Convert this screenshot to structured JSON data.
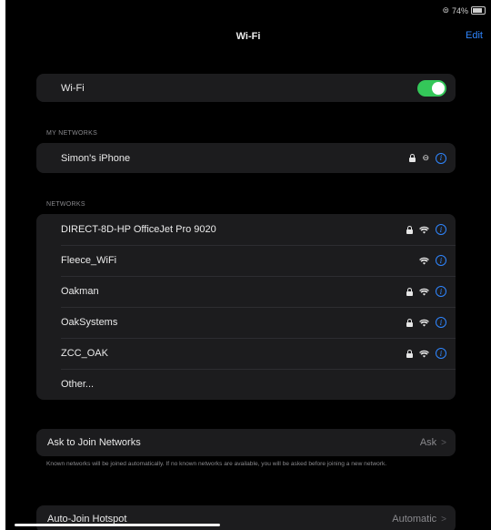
{
  "status_bar": {
    "battery_text": "74%"
  },
  "nav": {
    "title": "Wi-Fi",
    "edit_label": "Edit"
  },
  "wifi_row": {
    "label": "Wi-Fi",
    "enabled": true
  },
  "my_networks": {
    "header": "MY NETWORKS",
    "items": [
      {
        "name": "Simon's iPhone",
        "secured": true,
        "icon": "hotspot-link-icon"
      }
    ]
  },
  "networks": {
    "header": "NETWORKS",
    "items": [
      {
        "name": "DIRECT-8D-HP OfficeJet Pro 9020",
        "secured": true
      },
      {
        "name": "Fleece_WiFi",
        "secured": false
      },
      {
        "name": "Oakman",
        "secured": true
      },
      {
        "name": "OakSystems",
        "secured": true
      },
      {
        "name": "ZCC_OAK",
        "secured": true
      },
      {
        "name": "Other..."
      }
    ]
  },
  "ask_to_join": {
    "label": "Ask to Join Networks",
    "value": "Ask",
    "footnote": "Known networks will be joined automatically. If no known networks are available, you will be asked before joining a new network."
  },
  "auto_join": {
    "label": "Auto-Join Hotspot",
    "value": "Automatic"
  },
  "colors": {
    "accent": "#2f86ff",
    "toggle_on": "#34c759",
    "cell": "#1c1c1e",
    "background": "#000000"
  }
}
